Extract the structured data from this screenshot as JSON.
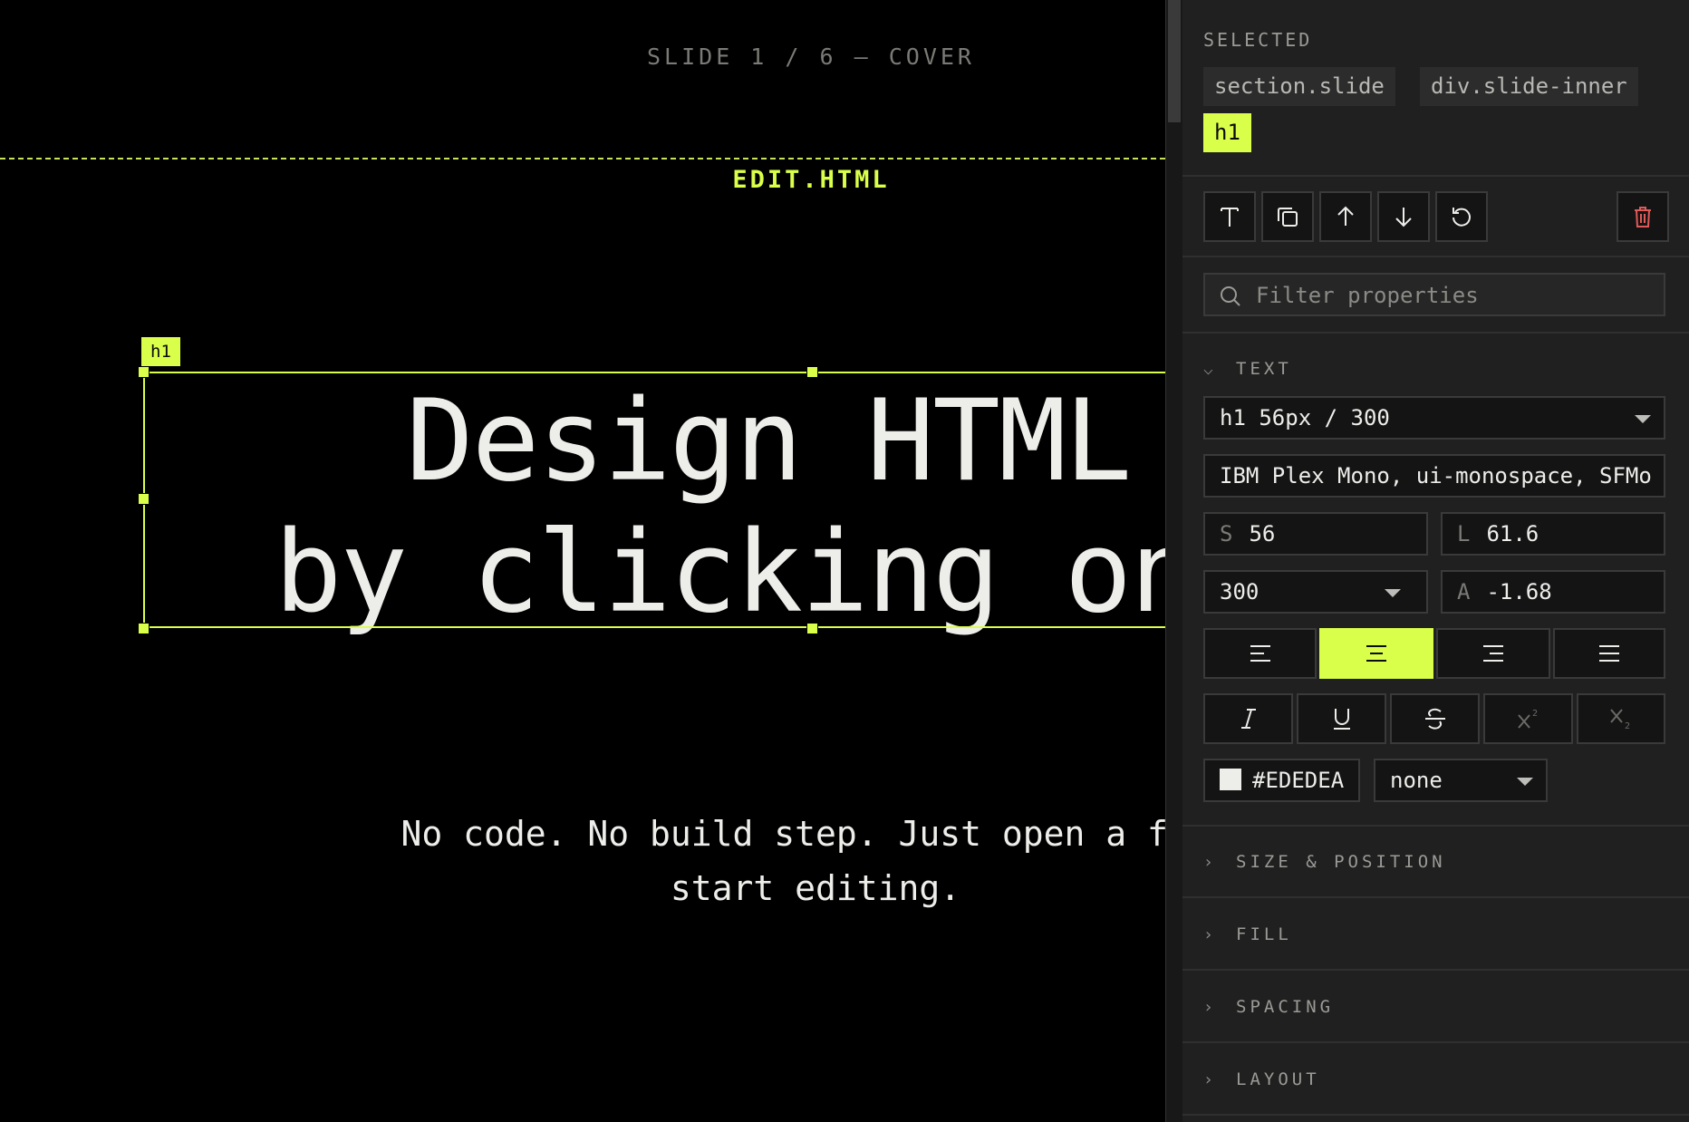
{
  "canvas": {
    "slide_label": "SLIDE 1 / 6 — COVER",
    "brand_label": "EDIT.HTML",
    "selection_tag": "h1",
    "headline_line1": "  Design HTML pa",
    "headline_line2": "by clicking on t",
    "subtext_line1": "No code. No build step. Just open a file",
    "subtext_line2": "start editing."
  },
  "panel": {
    "selected_title": "SELECTED",
    "breadcrumbs": [
      {
        "label": "section.slide",
        "active": false
      },
      {
        "label": "div.slide-inner",
        "active": false
      },
      {
        "label": "h1",
        "active": true
      }
    ],
    "toolbar": {
      "icons": [
        "text-icon",
        "duplicate-icon",
        "arrow-up-icon",
        "arrow-down-icon",
        "reset-icon",
        "trash-icon"
      ]
    },
    "filter_placeholder": "Filter properties",
    "text_section": {
      "title": "TEXT",
      "expanded": true,
      "style_preset": "h1 56px / 300",
      "font_family": "IBM Plex Mono, ui-monospace, SFMo",
      "size_prefix": "S",
      "size_value": "56",
      "line_prefix": "L",
      "line_value": "61.6",
      "weight_value": "300",
      "spacing_prefix": "A",
      "spacing_value": "-1.68",
      "align_options": [
        "align-left",
        "align-center",
        "align-right",
        "align-justify"
      ],
      "align_selected": "align-center",
      "style_options": [
        "italic",
        "underline",
        "strikethrough",
        "superscript",
        "subscript"
      ],
      "color_hex": "#EDEDEA",
      "decoration_value": "none"
    },
    "collapsed_sections": [
      {
        "title": "SIZE & POSITION"
      },
      {
        "title": "FILL"
      },
      {
        "title": "SPACING"
      },
      {
        "title": "LAYOUT"
      }
    ]
  },
  "colors": {
    "accent": "#d9ff4a",
    "background": "#000000",
    "panel": "#202020",
    "text": "#ededea",
    "danger": "#e05a5a"
  }
}
